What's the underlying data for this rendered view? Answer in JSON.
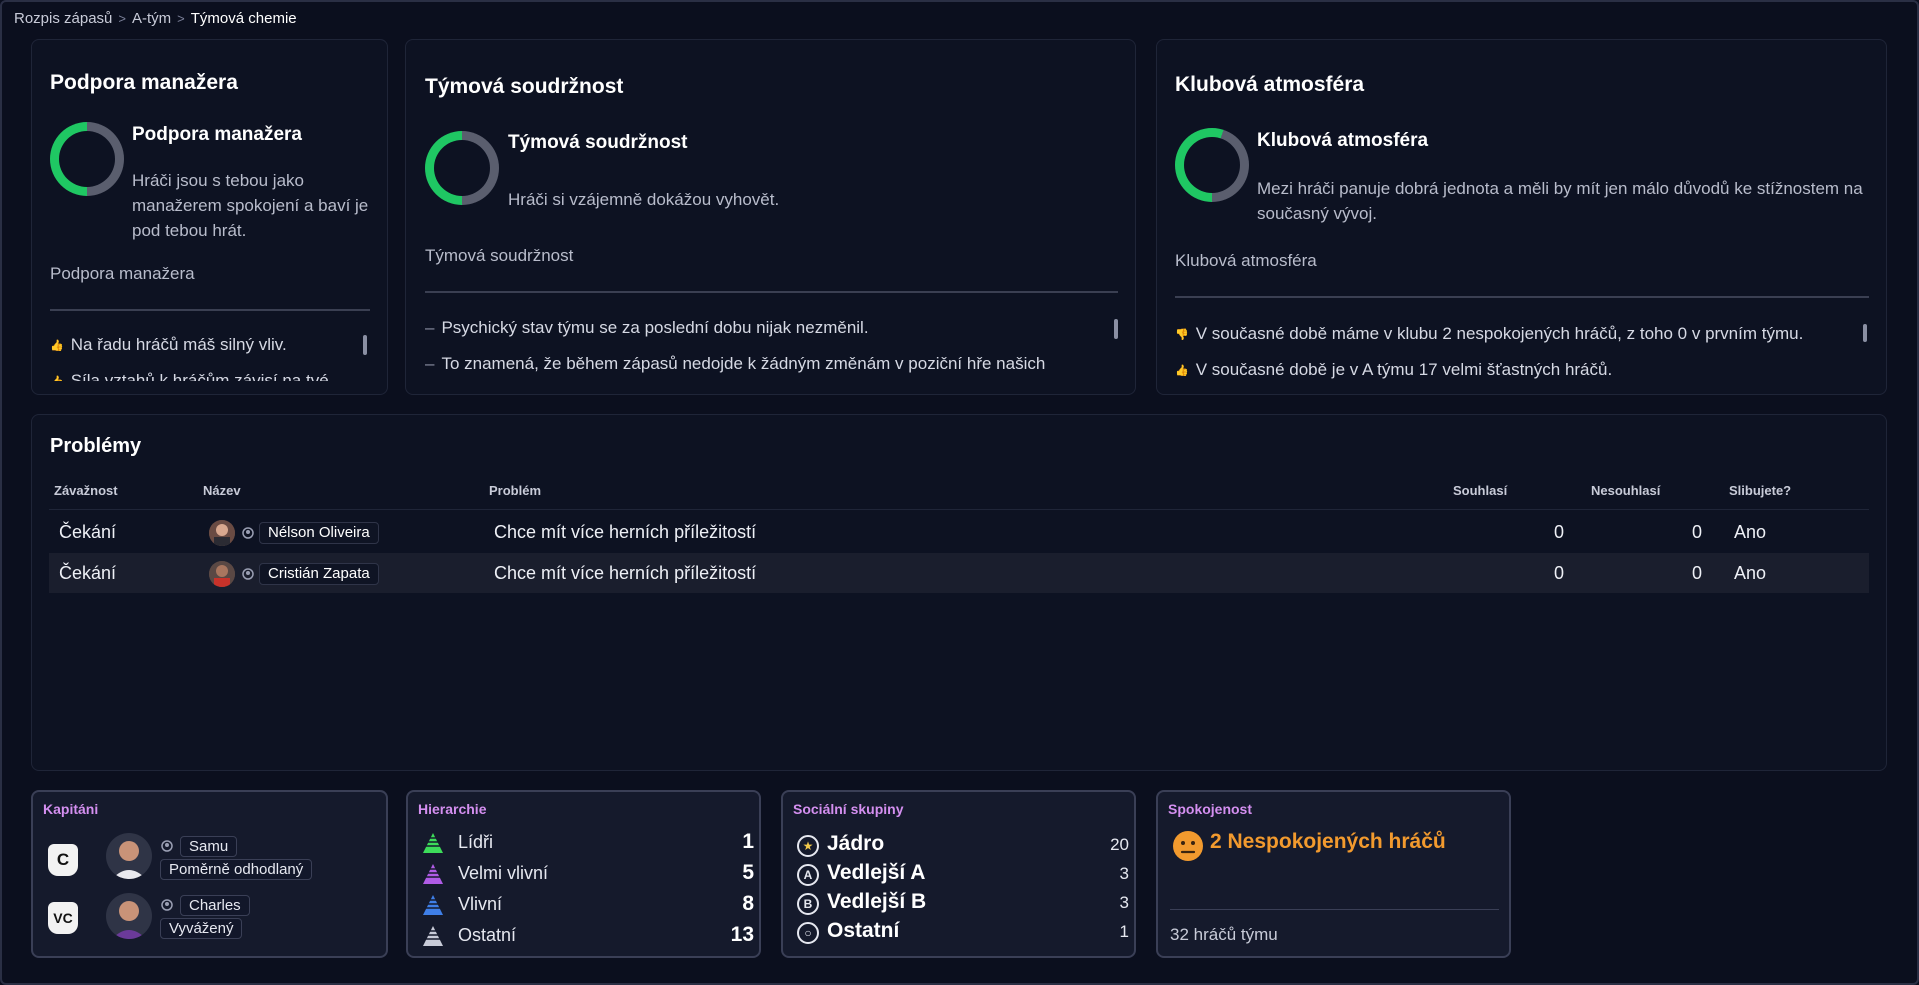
{
  "breadcrumb": [
    "Rozpis zápasů",
    "A-tým",
    "Týmová chemie"
  ],
  "manager_support": {
    "title": "Podpora manažera",
    "ring_title": "Podpora manažera",
    "description": "Hráči jsou s tebou jako manažerem spokojení a baví je pod tebou hrát.",
    "label": "Podpora manažera",
    "level": 0.5,
    "bullets": [
      "Na řadu hráčů máš silný vliv.",
      "Síla vztahů k hráčům závisí na tvé..."
    ]
  },
  "team_cohesion": {
    "title": "Týmová soudržnost",
    "ring_title": "Týmová soudržnost",
    "description": "Hráči si vzájemně dokážou vyhovět.",
    "label": "Týmová soudržnost",
    "level": 0.5,
    "bullets": [
      "Psychický stav týmu se za poslední dobu nijak nezměnil.",
      "To znamená, že během zápasů nedojde k žádným změnám v poziční hře našich"
    ]
  },
  "club_atmosphere": {
    "title": "Klubová atmosféra",
    "ring_title": "Klubová atmosféra",
    "description": "Mezi hráči panuje dobrá jednota a měli by mít jen málo důvodů ke stížnostem na současný vývoj.",
    "label": "Klubová atmosféra",
    "level": 0.55,
    "bullets": [
      "V současné době máme v klubu 2 nespokojených hráčů, z toho 0 v prvním týmu.",
      "V současné době je v A týmu 17 velmi šťastných hráčů."
    ]
  },
  "problems": {
    "title": "Problémy",
    "headers": {
      "severity": "Závažnost",
      "name": "Název",
      "problem": "Problém",
      "agree": "Souhlasí",
      "disagree": "Nesouhlasí",
      "promise": "Slibujete?"
    },
    "rows": [
      {
        "severity": "Čekání",
        "name": "Nélson Oliveira",
        "problem": "Chce mít více herních příležitostí",
        "agree": "0",
        "disagree": "0",
        "promise": "Ano"
      },
      {
        "severity": "Čekání",
        "name": "Cristián Zapata",
        "problem": "Chce mít více herních příležitostí",
        "agree": "0",
        "disagree": "0",
        "promise": "Ano"
      }
    ]
  },
  "captains": {
    "title": "Kapitáni",
    "items": [
      {
        "badge": "C",
        "name": "Samu",
        "trait": "Poměrně odhodlaný"
      },
      {
        "badge": "VC",
        "name": "Charles",
        "trait": "Vyvážený"
      }
    ]
  },
  "hierarchy": {
    "title": "Hierarchie",
    "items": [
      {
        "label": "Lídři",
        "value": "1",
        "color": "#3ddc5a"
      },
      {
        "label": "Velmi vlivní",
        "value": "5",
        "color": "#b05ce6"
      },
      {
        "label": "Vlivní",
        "value": "8",
        "color": "#3f7fe8"
      },
      {
        "label": "Ostatní",
        "value": "13",
        "color": "#c8cbd8"
      }
    ]
  },
  "social_groups": {
    "title": "Sociální skupiny",
    "items": [
      {
        "icon": "★",
        "label": "Jádro",
        "value": "20"
      },
      {
        "icon": "A",
        "label": "Vedlejší A",
        "value": "3"
      },
      {
        "icon": "B",
        "label": "Vedlejší B",
        "value": "3"
      },
      {
        "icon": "○",
        "label": "Ostatní",
        "value": "1"
      }
    ]
  },
  "satisfaction": {
    "title": "Spokojenost",
    "headline": "2 Nespokojených hráčů",
    "footer": "32 hráčů týmu"
  },
  "colors": {
    "accent_green": "#1fc763",
    "ring_track": "#5a5e6e",
    "orange": "#f29a2e",
    "purple": "#d48ff0"
  }
}
